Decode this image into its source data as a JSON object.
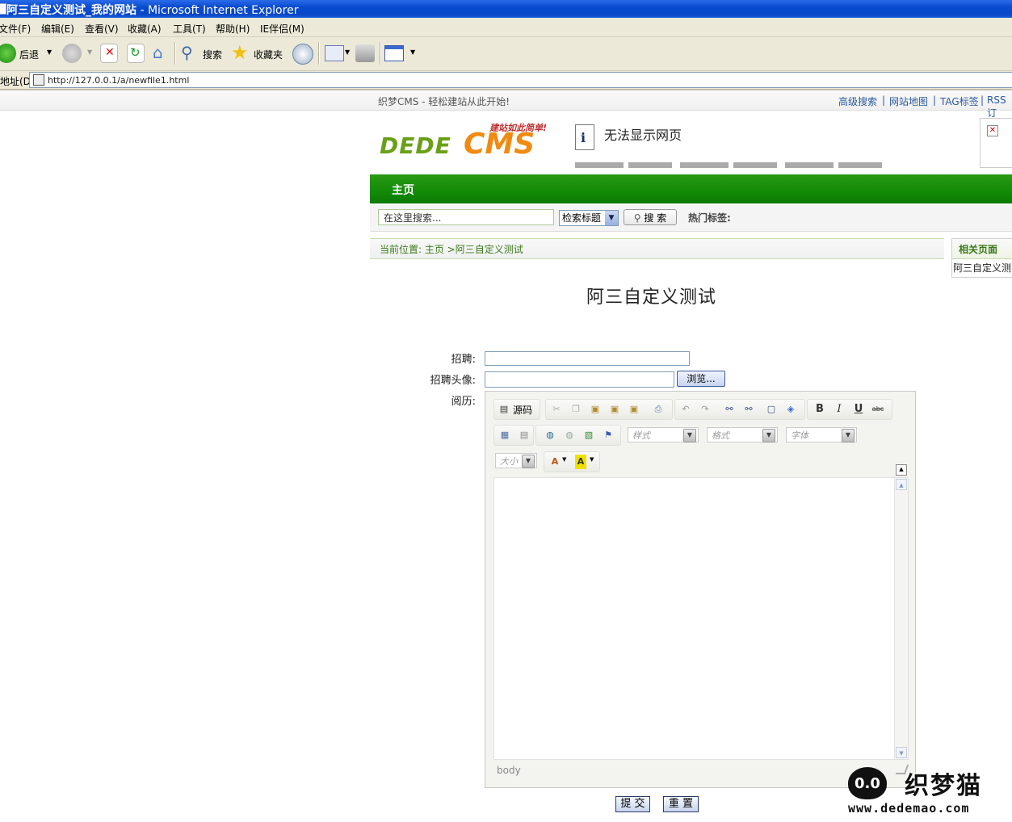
{
  "window": {
    "title": "阿三自定义测试_我的网站",
    "app": " - Microsoft Internet Explorer"
  },
  "menu": [
    "文件(F)",
    "编辑(E)",
    "查看(V)",
    "收藏(A)",
    "工具(T)",
    "帮助(H)",
    "IE伴侣(M)"
  ],
  "toolbar": {
    "back": "后退",
    "search": "搜索",
    "favorites": "收藏夹"
  },
  "address": {
    "label": "地址(D)",
    "url": "http://127.0.0.1/a/newfile1.html"
  },
  "site": {
    "slogan": "织梦CMS - 轻松建站从此开始!",
    "top_links": [
      "高级搜索",
      "网站地图",
      "TAG标签",
      "RSS订"
    ],
    "logo_tagline": "建站如此简单!",
    "logo_dede": "DEDE",
    "logo_cms": "CMS",
    "error_message": "无法显示网页",
    "nav_home": "主页",
    "search_placeholder": "在这里搜索...",
    "search_type": "检索标题",
    "search_button": "搜 索",
    "hot_tags": "热门标签:",
    "breadcrumb": "当前位置: 主页 >阿三自定义测试",
    "related_heading": "相关页面",
    "related_item": "阿三自定义测"
  },
  "article": {
    "title": "阿三自定义测试"
  },
  "form": {
    "field1_label": "招聘:",
    "field2_label": "招聘头像:",
    "field3_label": "阅历:",
    "browse_button": "浏览...",
    "submit_button": "提 交",
    "reset_button": "重 置"
  },
  "editor": {
    "source_label": "源码",
    "style_combo": "样式",
    "format_combo": "格式",
    "font_combo": "字体",
    "size_combo": "大小",
    "status_path": "body"
  },
  "watermark": {
    "logo_text": "0.0",
    "name": "织梦猫",
    "url": "www.dedemao.com"
  }
}
